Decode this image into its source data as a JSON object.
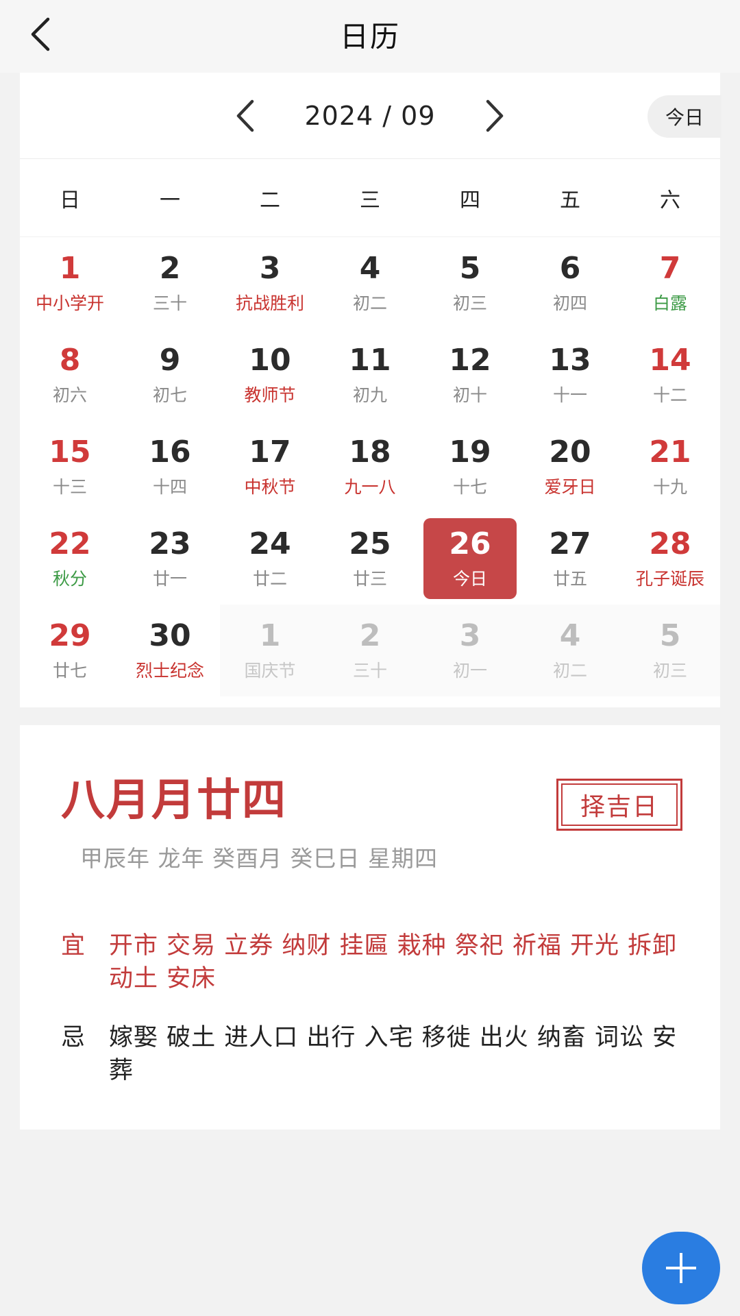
{
  "header": {
    "title": "日历"
  },
  "calendar": {
    "month_label": "2024 / 09",
    "today_button": "今日",
    "weekdays": [
      "日",
      "一",
      "二",
      "三",
      "四",
      "五",
      "六"
    ],
    "days": [
      {
        "num": "1",
        "sub": "中小学开",
        "sub_color": "red",
        "weekend": true
      },
      {
        "num": "2",
        "sub": "三十"
      },
      {
        "num": "3",
        "sub": "抗战胜利",
        "sub_color": "red"
      },
      {
        "num": "4",
        "sub": "初二"
      },
      {
        "num": "5",
        "sub": "初三"
      },
      {
        "num": "6",
        "sub": "初四"
      },
      {
        "num": "7",
        "sub": "白露",
        "sub_color": "green",
        "weekend": true
      },
      {
        "num": "8",
        "sub": "初六",
        "weekend": true
      },
      {
        "num": "9",
        "sub": "初七"
      },
      {
        "num": "10",
        "sub": "教师节",
        "sub_color": "red"
      },
      {
        "num": "11",
        "sub": "初九"
      },
      {
        "num": "12",
        "sub": "初十"
      },
      {
        "num": "13",
        "sub": "十一"
      },
      {
        "num": "14",
        "sub": "十二",
        "weekend": true
      },
      {
        "num": "15",
        "sub": "十三",
        "weekend": true
      },
      {
        "num": "16",
        "sub": "十四"
      },
      {
        "num": "17",
        "sub": "中秋节",
        "sub_color": "red"
      },
      {
        "num": "18",
        "sub": "九一八",
        "sub_color": "red"
      },
      {
        "num": "19",
        "sub": "十七"
      },
      {
        "num": "20",
        "sub": "爱牙日",
        "sub_color": "red"
      },
      {
        "num": "21",
        "sub": "十九",
        "weekend": true
      },
      {
        "num": "22",
        "sub": "秋分",
        "sub_color": "green",
        "weekend": true
      },
      {
        "num": "23",
        "sub": "廿一"
      },
      {
        "num": "24",
        "sub": "廿二"
      },
      {
        "num": "25",
        "sub": "廿三"
      },
      {
        "num": "26",
        "sub": "今日",
        "today": true
      },
      {
        "num": "27",
        "sub": "廿五"
      },
      {
        "num": "28",
        "sub": "孔子诞辰",
        "sub_color": "red",
        "weekend": true
      },
      {
        "num": "29",
        "sub": "廿七",
        "weekend": true
      },
      {
        "num": "30",
        "sub": "烈士纪念",
        "sub_color": "red"
      },
      {
        "num": "1",
        "sub": "国庆节",
        "other": true
      },
      {
        "num": "2",
        "sub": "三十",
        "other": true
      },
      {
        "num": "3",
        "sub": "初一",
        "other": true
      },
      {
        "num": "4",
        "sub": "初二",
        "other": true
      },
      {
        "num": "5",
        "sub": "初三",
        "other": true
      }
    ]
  },
  "detail": {
    "lunar_date": "八月月廿四",
    "auspicious_button": "择吉日",
    "ganzhi": "甲辰年 龙年 癸酉月 癸巳日 星期四",
    "yi_label": "宜",
    "yi_text": "开市 交易 立券 纳财 挂匾 栽种 祭祀 祈福 开光 拆卸 动土 安床",
    "ji_label": "忌",
    "ji_text": "嫁娶 破土 进人口 出行 入宅 移徙 出火 纳畜 词讼 安葬"
  },
  "colors": {
    "accent_red": "#c23b3b",
    "today_bg": "#c64748",
    "festival_green": "#3c9a45",
    "fab_blue": "#2a7de1"
  },
  "icons": {
    "back": "back-arrow-icon",
    "prev": "chevron-left-icon",
    "next": "chevron-right-icon",
    "fab": "plus-icon"
  }
}
